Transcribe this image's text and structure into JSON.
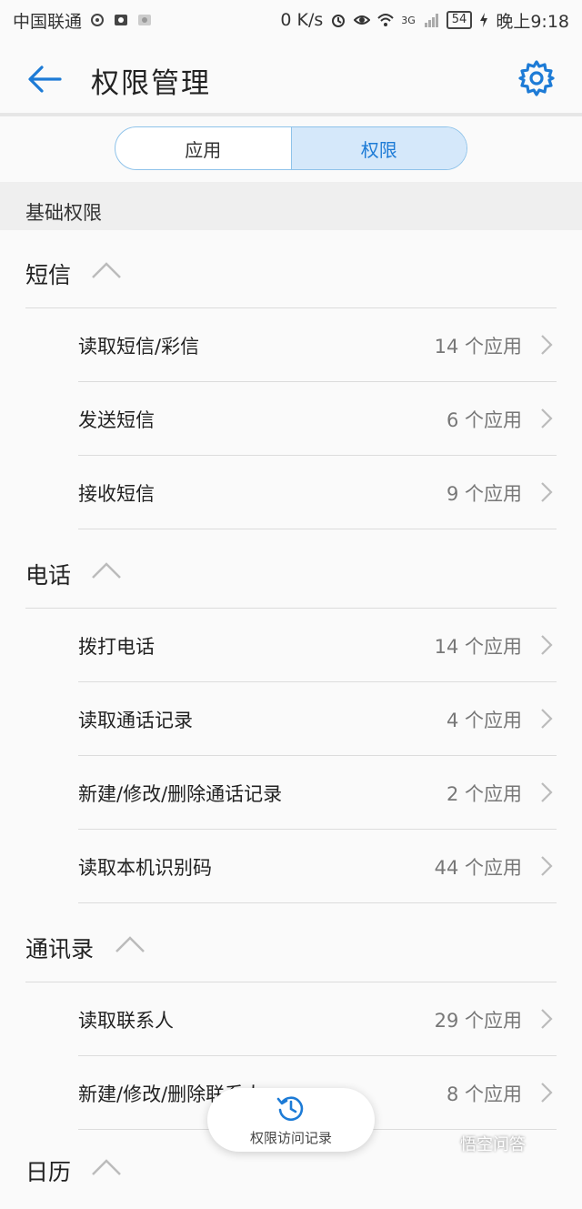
{
  "status_bar": {
    "carrier": "中国联通",
    "net_speed": "0 K/s",
    "network_type": "3G",
    "battery": "54",
    "time": "晚上9:18"
  },
  "app_bar": {
    "title": "权限管理"
  },
  "tabs": {
    "apps": "应用",
    "permissions": "权限",
    "selected": "权限"
  },
  "section": {
    "title": "基础权限"
  },
  "groups": [
    {
      "title": "短信",
      "items": [
        {
          "label": "读取短信/彩信",
          "count": "14 个应用"
        },
        {
          "label": "发送短信",
          "count": "6 个应用"
        },
        {
          "label": "接收短信",
          "count": "9 个应用"
        }
      ]
    },
    {
      "title": "电话",
      "items": [
        {
          "label": "拨打电话",
          "count": "14 个应用"
        },
        {
          "label": "读取通话记录",
          "count": "4 个应用"
        },
        {
          "label": "新建/修改/删除通话记录",
          "count": "2 个应用"
        },
        {
          "label": "读取本机识别码",
          "count": "44 个应用"
        }
      ]
    },
    {
      "title": "通讯录",
      "items": [
        {
          "label": "读取联系人",
          "count": "29 个应用"
        },
        {
          "label": "新建/修改/删除联系人",
          "count": "8 个应用"
        }
      ]
    },
    {
      "title": "日历",
      "items": []
    }
  ],
  "fab": {
    "label": "权限访问记录"
  },
  "watermark": "悟空问答",
  "colors": {
    "accent": "#1d7bd6",
    "background": "#fafafa",
    "section_bg": "#efefef"
  },
  "icons": [
    "back-arrow-icon",
    "gear-icon",
    "chevron-up-icon",
    "chevron-right-icon",
    "history-clock-icon"
  ]
}
